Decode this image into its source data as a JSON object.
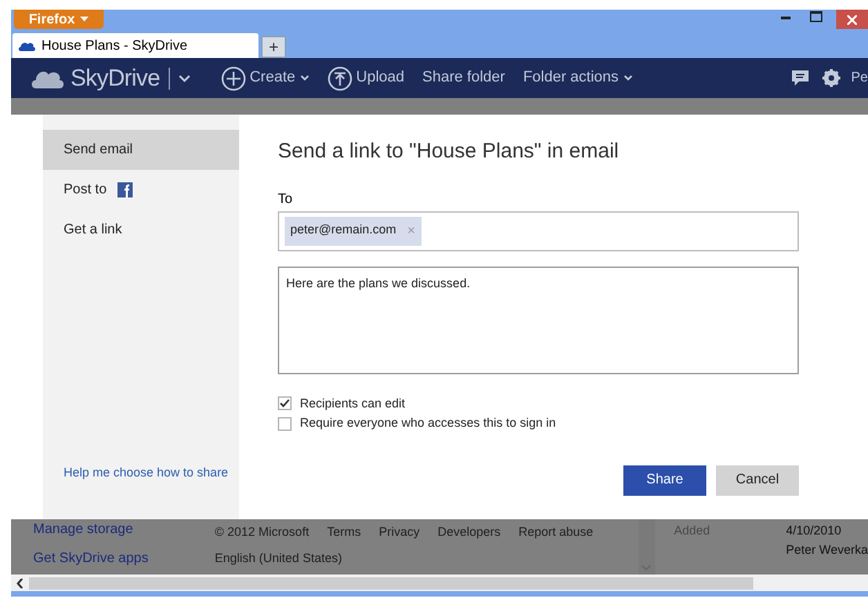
{
  "browser": {
    "menu_button": "Firefox",
    "tab": {
      "title": "House Plans - SkyDrive"
    },
    "new_tab": "+"
  },
  "nav": {
    "brand": "SkyDrive",
    "actions": [
      {
        "label": "Create",
        "kind": "create"
      },
      {
        "label": "Upload",
        "kind": "upload"
      },
      {
        "label": "Share folder",
        "kind": "plain"
      },
      {
        "label": "Folder actions",
        "kind": "menu"
      }
    ],
    "user": "Pe"
  },
  "share_dialog": {
    "options": [
      {
        "label": "Send email",
        "selected": true,
        "kind": "plain"
      },
      {
        "label": "Post to",
        "selected": false,
        "kind": "facebook"
      },
      {
        "label": "Get a link",
        "selected": false,
        "kind": "plain"
      }
    ],
    "help_link": "Help me choose how to share",
    "title": "Send a link to \"House Plans\" in email",
    "to_label": "To",
    "recipients": [
      {
        "address": "peter@remain.com",
        "remove": "×"
      }
    ],
    "message": "Here are the plans we discussed.",
    "checkboxes": [
      {
        "label": "Recipients can edit",
        "checked": true
      },
      {
        "label": "Require everyone who accesses this to sign in",
        "checked": false
      }
    ],
    "buttons": [
      {
        "label": "Share",
        "kind": "primary"
      },
      {
        "label": "Cancel",
        "kind": "secondary"
      }
    ]
  },
  "footer": {
    "links": [
      "Manage storage",
      "Get SkyDrive apps"
    ],
    "legal": [
      "© 2012 Microsoft",
      "Terms",
      "Privacy",
      "Developers",
      "Report abuse"
    ],
    "language": "English (United States)",
    "details": {
      "label": "Added",
      "date": "4/10/2010",
      "author": "Peter Weverka"
    }
  }
}
